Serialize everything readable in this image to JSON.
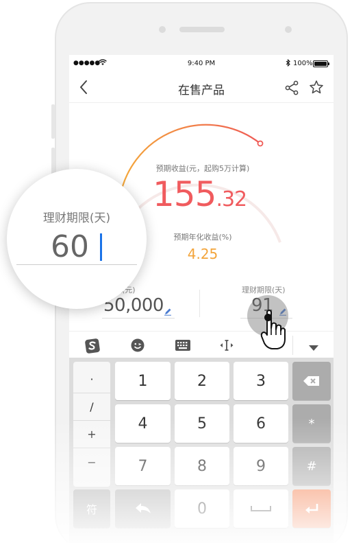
{
  "status_bar": {
    "signal": "●●●●●",
    "time": "9:40 PM",
    "battery": "100%"
  },
  "nav": {
    "title": "在售产品"
  },
  "product": {
    "expected_income_label": "预期收益(元，起购5万计算)",
    "expected_income_int": "155",
    "expected_income_dec": ".32",
    "annual_rate_label": "预期年化收益(%)",
    "annual_rate_value": "4.25",
    "amount_label": "投资金额(元)",
    "amount_label_visible": "资金额(元)",
    "amount_value": "50,000",
    "term_label": "理财期限(天)",
    "term_value": "91"
  },
  "magnifier": {
    "label": "理财期限(天)",
    "value": "60"
  },
  "keyboard": {
    "symbols": [
      "·",
      "/",
      "+",
      "−"
    ],
    "digits": [
      "1",
      "2",
      "3",
      "4",
      "5",
      "6",
      "7",
      "8",
      "9"
    ],
    "zero": "0",
    "fu": "符",
    "asterisk": "*",
    "hash": "#"
  },
  "colors": {
    "income": "#f05b5e",
    "rate": "#f3a43a",
    "enter_key": "#f37845"
  },
  "icons": [
    "back-icon",
    "share-icon",
    "star-icon",
    "sogou-icon",
    "emoji-icon",
    "keyboard-icon",
    "cursor-icon",
    "collapse-icon",
    "backspace-icon",
    "return-icon",
    "space-icon",
    "enter-icon",
    "pen-icon",
    "hand-pointer-icon"
  ]
}
